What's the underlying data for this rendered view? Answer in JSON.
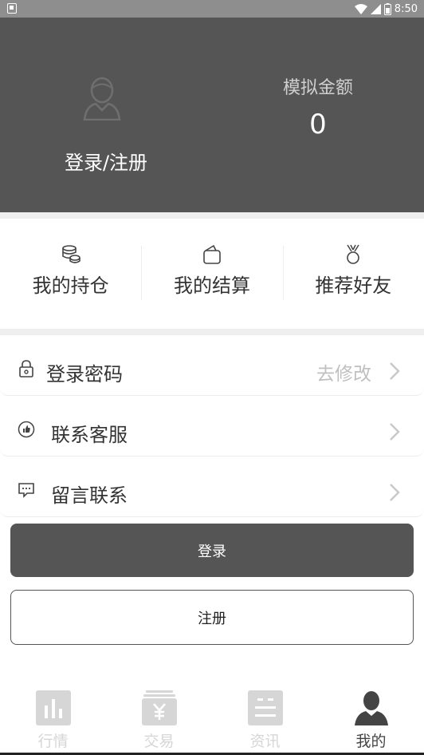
{
  "status_bar": {
    "time": "8:50"
  },
  "header": {
    "login_link": "登录/注册",
    "sim_amount_label": "模拟金额",
    "sim_amount_value": "0"
  },
  "quick_actions": [
    {
      "label": "我的持仓",
      "icon": "coins-stack-icon"
    },
    {
      "label": "我的结算",
      "icon": "wallet-icon"
    },
    {
      "label": "推荐好友",
      "icon": "medal-icon"
    }
  ],
  "menu": [
    {
      "label": "登录密码",
      "value": "去修改",
      "icon": "lock-icon"
    },
    {
      "label": "联系客服",
      "value": "",
      "icon": "thumbs-up-icon"
    },
    {
      "label": "留言联系",
      "value": "",
      "icon": "message-icon"
    }
  ],
  "buttons": {
    "login": "登录",
    "register": "注册"
  },
  "tabbar": [
    {
      "label": "行情",
      "icon": "chart-icon",
      "active": false
    },
    {
      "label": "交易",
      "icon": "yen-icon",
      "active": false
    },
    {
      "label": "资讯",
      "icon": "news-icon",
      "active": false
    },
    {
      "label": "我的",
      "icon": "user-icon",
      "active": true
    }
  ],
  "colors": {
    "header_bg": "#555556",
    "button_bg": "#555556",
    "tab_inactive": "#d6d6d6"
  }
}
